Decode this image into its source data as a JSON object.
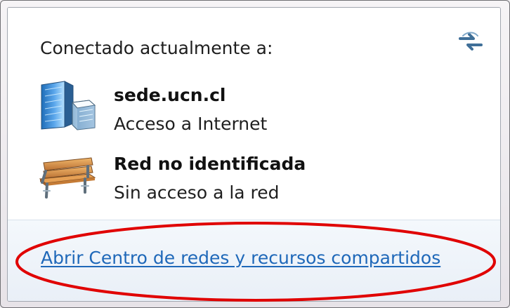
{
  "popup": {
    "header": "Conectado actualmente a:",
    "networks": [
      {
        "name": "sede.ucn.cl",
        "status": "Acceso a Internet",
        "icon": "domain-network-icon"
      },
      {
        "name": "Red no identificada",
        "status": "Sin acceso a la red",
        "icon": "bench-network-icon"
      }
    ],
    "link": "Abrir Centro de redes y recursos compartidos",
    "refresh_icon": "refresh-icon"
  },
  "colors": {
    "link": "#1f68b9",
    "annotation": "#e00000",
    "panel_bottom": "#eaf0f7"
  }
}
